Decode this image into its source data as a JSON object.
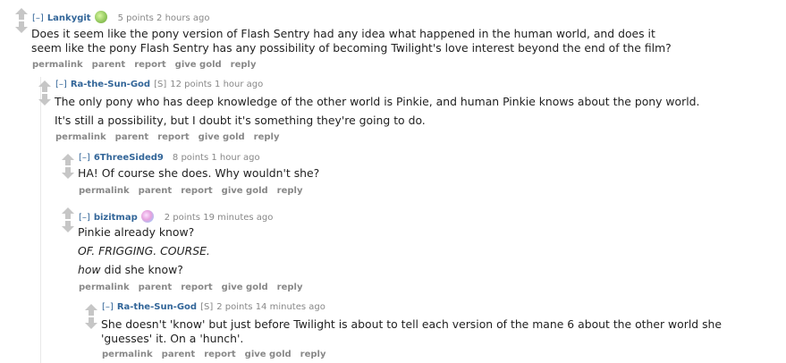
{
  "comments": [
    {
      "expand": "[–]",
      "author": "Lankygit",
      "score": "5 points",
      "time": "2 hours ago",
      "flair_icon": "pony-flair-icon",
      "body": [
        "Does it seem like the pony version of Flash Sentry had any idea what happened in the human world, and does it",
        "seem like the pony Flash Sentry has any possibility of becoming Twilight's love interest beyond the end of the film?"
      ]
    },
    {
      "expand": "[–]",
      "author": "Ra-the-Sun-God",
      "submitter": "[S]",
      "score": "12 points",
      "time": "1 hour ago",
      "body": [
        "The only pony who has deep knowledge of the other world is Pinkie, and human Pinkie knows about the pony world.",
        "It's still a possibility, but I doubt it's something they're going to do."
      ]
    },
    {
      "expand": "[–]",
      "author": "6ThreeSided9",
      "score": "8 points",
      "time": "1 hour ago",
      "body": [
        "HA! Of course she does. Why wouldn't she?"
      ]
    },
    {
      "expand": "[–]",
      "author": "bizitmap",
      "score": "2 points",
      "time": "19 minutes ago",
      "flair_icon": "pony-flair-icon",
      "body": [
        "Pinkie already know?",
        "OF. FRIGGING. COURSE.",
        "how",
        " did she know?"
      ]
    },
    {
      "expand": "[–]",
      "author": "Ra-the-Sun-God",
      "submitter": "[S]",
      "score": "2 points",
      "time": "14 minutes ago",
      "body": [
        "She doesn't 'know' but just before Twilight is about to tell each version of the mane 6 about the other world she",
        "'guesses' it. On a 'hunch'."
      ]
    }
  ],
  "actions": {
    "permalink": "permalink",
    "parent": "parent",
    "report": "report",
    "give_gold": "give gold",
    "reply": "reply"
  },
  "colors": {
    "author": "#336699",
    "meta": "#888888",
    "arrow": "#c6c6c6"
  }
}
